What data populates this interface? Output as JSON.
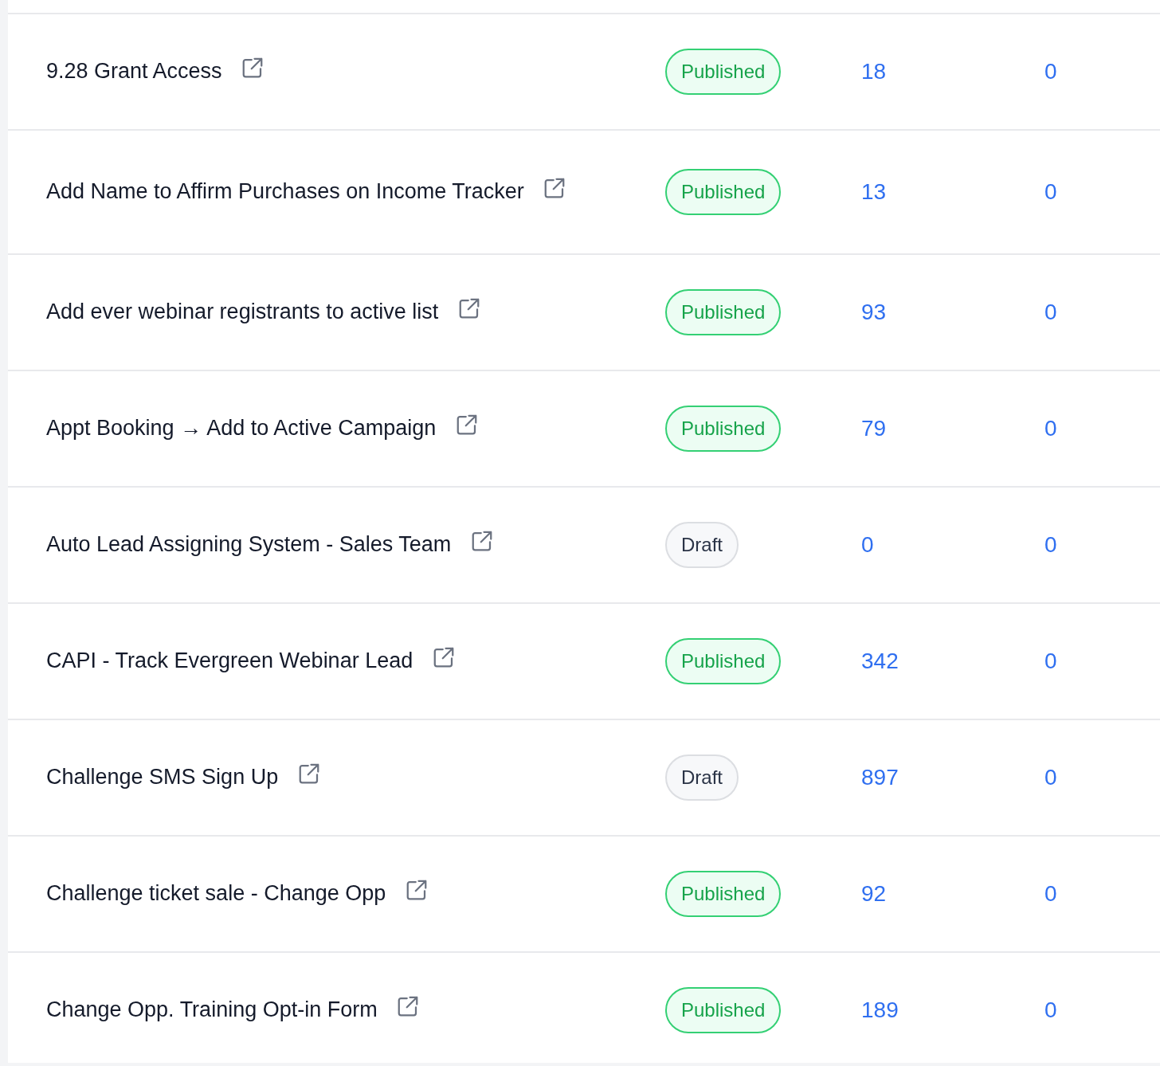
{
  "rows": [
    {
      "name": "9.28 Grant Access",
      "status": {
        "label": "Published",
        "kind": "published"
      },
      "count": "18",
      "column_4": "0"
    },
    {
      "name": "Add Name to Affirm Purchases on Income Tracker",
      "status": {
        "label": "Published",
        "kind": "published"
      },
      "count": "13",
      "column_4": "0"
    },
    {
      "name": "Add ever webinar registrants to active list",
      "status": {
        "label": "Published",
        "kind": "published"
      },
      "count": "93",
      "column_4": "0"
    },
    {
      "name": "Appt Booking → Add to Active Campaign",
      "status": {
        "label": "Published",
        "kind": "published"
      },
      "count": "79",
      "column_4": "0"
    },
    {
      "name": "Auto Lead Assigning System - Sales Team",
      "status": {
        "label": "Draft",
        "kind": "draft"
      },
      "count": "0",
      "column_4": "0"
    },
    {
      "name": "CAPI - Track Evergreen Webinar Lead",
      "status": {
        "label": "Published",
        "kind": "published"
      },
      "count": "342",
      "column_4": "0"
    },
    {
      "name": "Challenge SMS Sign Up",
      "status": {
        "label": "Draft",
        "kind": "draft"
      },
      "count": "897",
      "column_4": "0"
    },
    {
      "name": "Challenge ticket sale - Change Opp",
      "status": {
        "label": "Published",
        "kind": "published"
      },
      "count": "92",
      "column_4": "0"
    },
    {
      "name": "Change Opp. Training Opt-in Form",
      "status": {
        "label": "Published",
        "kind": "published"
      },
      "count": "189",
      "column_4": "0"
    }
  ]
}
